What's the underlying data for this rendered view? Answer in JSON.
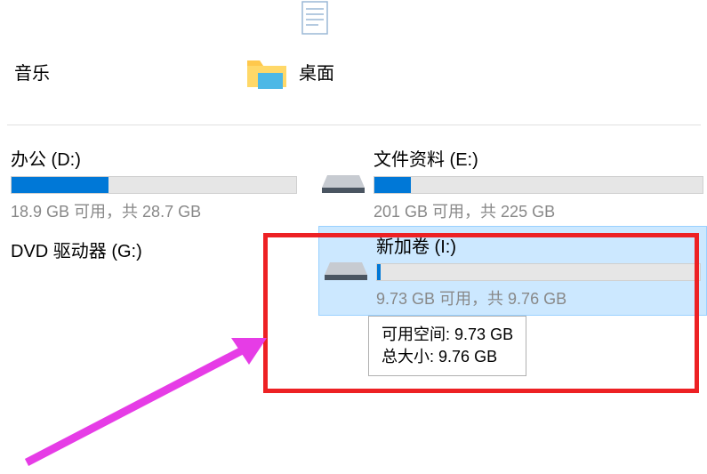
{
  "folders": {
    "music_label": "音乐",
    "desktop_label": "桌面"
  },
  "drives": {
    "d": {
      "name": "办公 (D:)",
      "stats": "18.9 GB 可用，共 28.7 GB",
      "fill_percent": 34
    },
    "e": {
      "name": "文件资料 (E:)",
      "stats": "201 GB 可用，共 225 GB",
      "fill_percent": 11
    },
    "g": {
      "name": "DVD 驱动器 (G:)"
    },
    "i": {
      "name": "新加卷 (I:)",
      "stats": "9.73 GB 可用，共 9.76 GB",
      "fill_percent": 1
    }
  },
  "tooltip": {
    "available_label": "可用空间:",
    "available_value": "9.73 GB",
    "total_label": "总大小:",
    "total_value": "9.76 GB"
  }
}
